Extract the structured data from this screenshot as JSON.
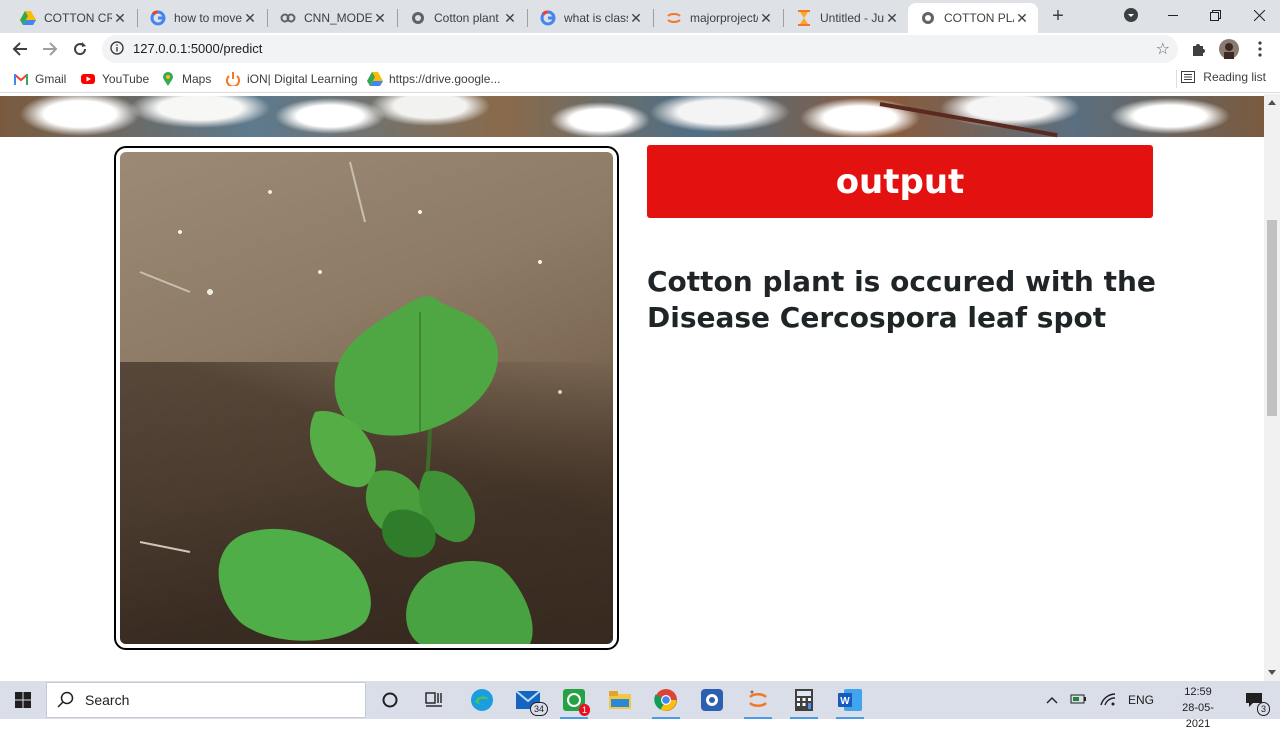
{
  "browser": {
    "tabs": [
      {
        "title": "COTTON CRO",
        "icon": "google-drive-icon",
        "active": false
      },
      {
        "title": "how to move",
        "icon": "google-icon",
        "active": false
      },
      {
        "title": "CNN_MODEL",
        "icon": "colab-icon",
        "active": false
      },
      {
        "title": "Cotton plant",
        "icon": "globe-icon",
        "active": false
      },
      {
        "title": "what is classif",
        "icon": "google-icon",
        "active": false
      },
      {
        "title": "majorproject/",
        "icon": "jupyter-icon",
        "active": false
      },
      {
        "title": "Untitled - Jup",
        "icon": "hourglass-icon",
        "active": false
      },
      {
        "title": "COTTON PLA",
        "icon": "globe-icon",
        "active": true
      }
    ],
    "url": "127.0.0.1:5000/predict",
    "bookmarks": [
      {
        "label": "Gmail",
        "icon": "gmail-icon"
      },
      {
        "label": "YouTube",
        "icon": "youtube-icon"
      },
      {
        "label": "Maps",
        "icon": "maps-icon"
      },
      {
        "label": "iON| Digital Learning",
        "icon": "ion-icon"
      },
      {
        "label": "https://drive.google...",
        "icon": "google-drive-icon"
      }
    ],
    "reading_list": "Reading list"
  },
  "page": {
    "output_label": "output",
    "result_line1": "Cotton plant is occured with the",
    "result_line2": "Disease Cercospora leaf spot",
    "accent_color": "#e41111"
  },
  "taskbar": {
    "search_label": "Search",
    "mail_badge": "34",
    "app_badge": "1",
    "language": "ENG",
    "time": "12:59",
    "date": "28-05-2021",
    "notification_count": "3"
  }
}
